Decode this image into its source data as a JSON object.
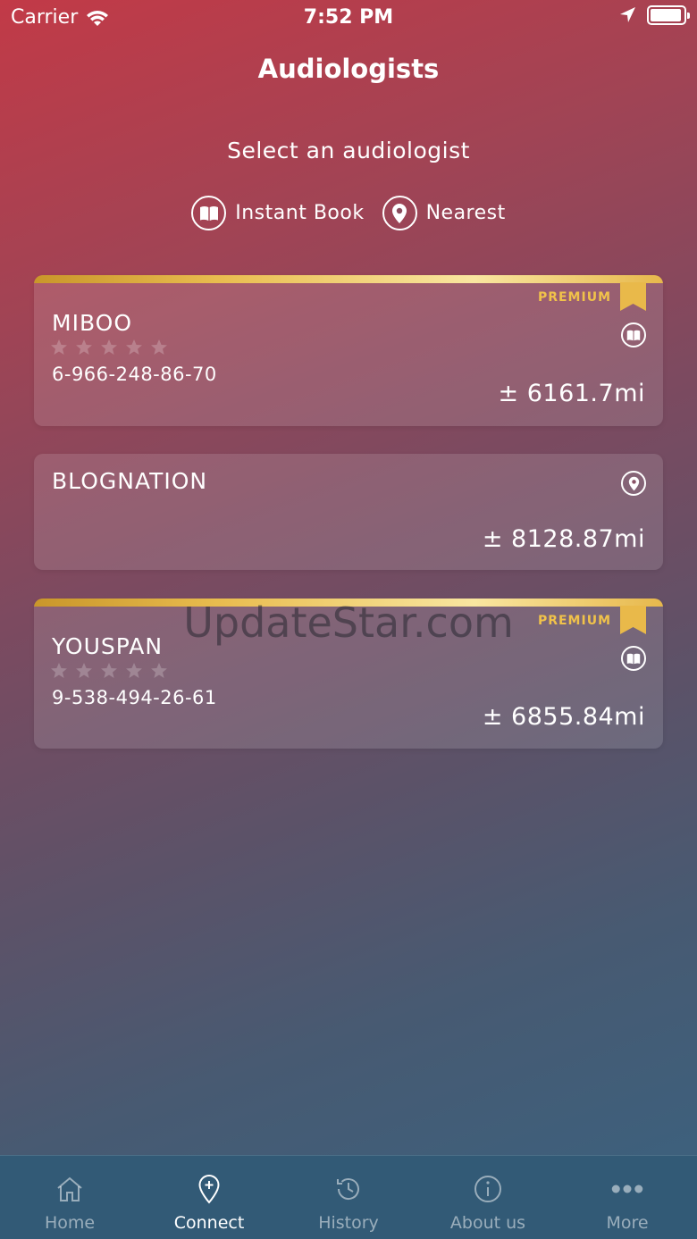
{
  "status_bar": {
    "carrier": "Carrier",
    "time": "7:52 PM"
  },
  "header": {
    "title": "Audiologists"
  },
  "subtitle": "Select an audiologist",
  "filters": [
    {
      "label": "Instant Book",
      "icon": "book-icon"
    },
    {
      "label": "Nearest",
      "icon": "location-pin-icon"
    }
  ],
  "premium_label": "PREMIUM",
  "cards": [
    {
      "name": "MIBOO",
      "phone": "6-966-248-86-70",
      "distance": "± 6161.7mi",
      "premium": true,
      "rating": 0,
      "badge_icon": "book-icon"
    },
    {
      "name": "BLOGNATION",
      "distance": "± 8128.87mi",
      "premium": false,
      "badge_icon": "location-pin-icon"
    },
    {
      "name": "YOUSPAN",
      "phone": "9-538-494-26-61",
      "distance": "± 6855.84mi",
      "premium": true,
      "rating": 0,
      "badge_icon": "book-icon"
    }
  ],
  "watermark": "UpdateStar.com",
  "tab_bar": {
    "active": "Connect",
    "tabs": [
      {
        "label": "Home",
        "icon": "home-icon"
      },
      {
        "label": "Connect",
        "icon": "location-plus-icon"
      },
      {
        "label": "History",
        "icon": "history-clock-icon"
      },
      {
        "label": "About us",
        "icon": "info-icon"
      },
      {
        "label": "More",
        "icon": "more-dots-icon"
      }
    ]
  },
  "colors": {
    "premium_gold": "#f0c24a",
    "tab_bar_bg": "#325a76"
  }
}
